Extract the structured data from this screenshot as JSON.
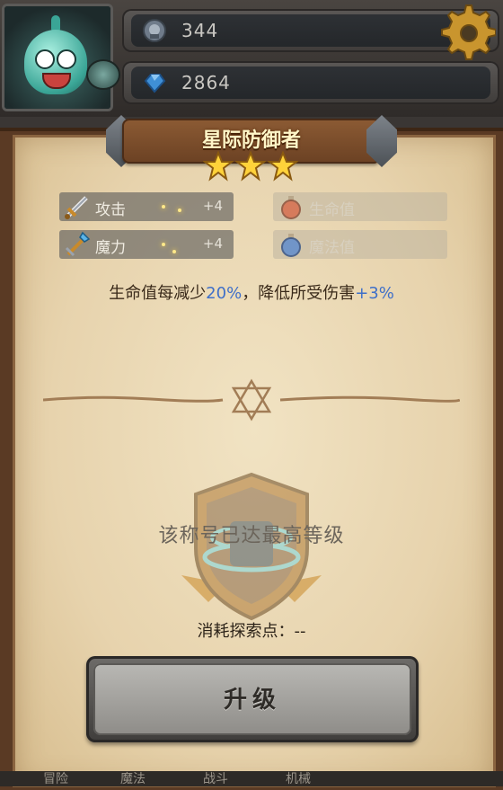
{
  "header": {
    "resources": [
      {
        "icon": "exploration-token-icon",
        "value": "344"
      },
      {
        "icon": "blue-gem-icon",
        "value": "2864"
      }
    ],
    "settings_icon": "gear-icon"
  },
  "title": {
    "name": "星际防御者",
    "stars": 3
  },
  "stats": {
    "attack": {
      "label": "攻击",
      "bonus": "+4"
    },
    "magic": {
      "label": "魔力",
      "bonus": "+4"
    },
    "hp": {
      "label": "生命值"
    },
    "mp": {
      "label": "魔法值"
    }
  },
  "effect": {
    "text_a": "生命值每减少",
    "value_a": "20%",
    "text_b": "，降低所受伤害",
    "value_b": "+3%"
  },
  "status": {
    "max_level_message": "该称号已达最高等级",
    "cost_text": "消耗探索点：--"
  },
  "actions": {
    "upgrade_label": "升级"
  },
  "bottom_tabs": [
    "冒险",
    "魔法",
    "战斗",
    "机械"
  ],
  "colors": {
    "highlight_blue": "#3e6fc9",
    "parchment": "#e7d3ad",
    "title_text": "#fff6c8"
  }
}
